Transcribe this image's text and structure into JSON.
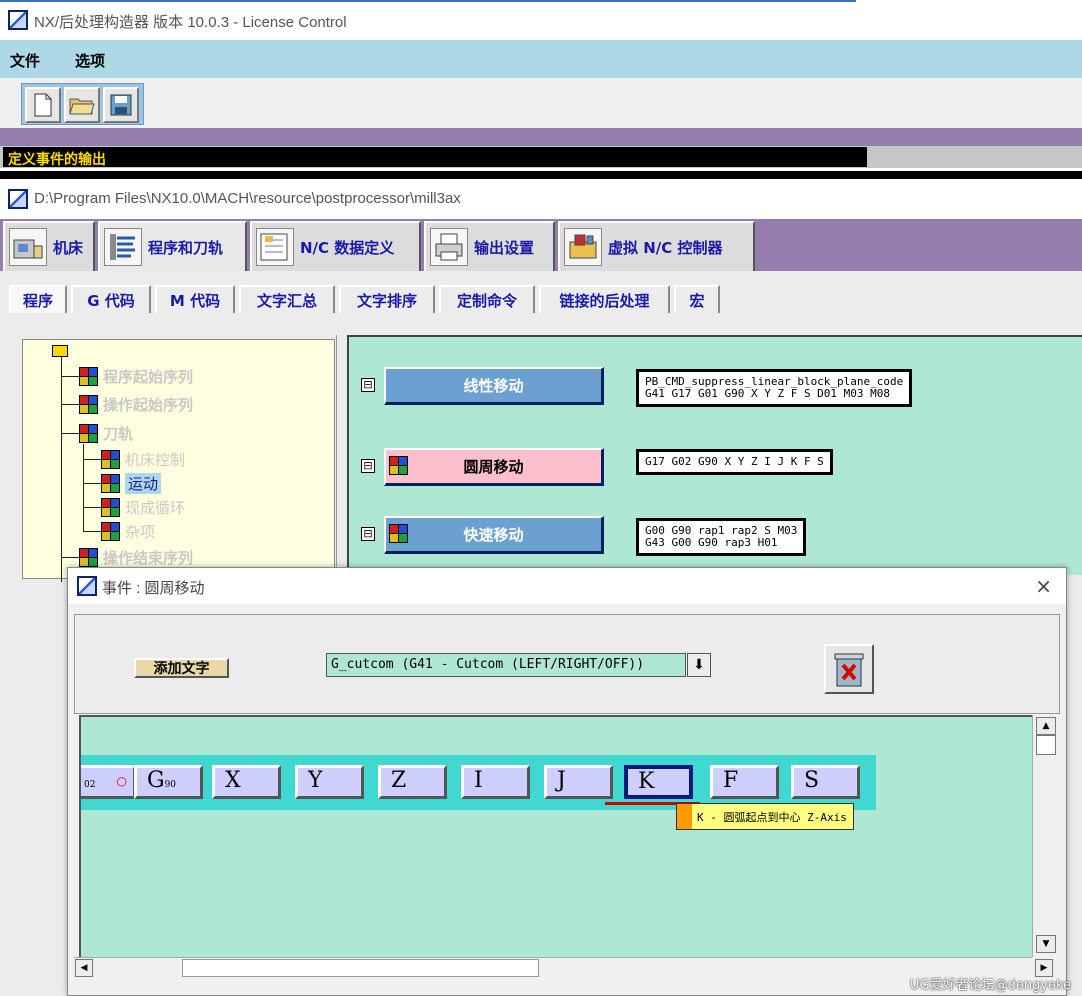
{
  "app": {
    "title": "NX/后处理构造器 版本 10.0.3 - License Control",
    "menu": [
      "文件",
      "选项"
    ],
    "toolbar": [
      "new-file-icon",
      "open-folder-icon",
      "save-disk-icon"
    ],
    "status_text": "定义事件的输出"
  },
  "post_window": {
    "path": "D:\\Program Files\\NX10.0\\MACH\\resource\\postprocessor\\mill3ax",
    "main_tabs": [
      {
        "label": "机床",
        "icon": "machine-tool-icon"
      },
      {
        "label": "程序和刀轨",
        "icon": "program-path-icon",
        "active": true
      },
      {
        "label": "N/C 数据定义",
        "icon": "nc-data-icon"
      },
      {
        "label": "输出设置",
        "icon": "printer-icon"
      },
      {
        "label": "虚拟 N/C 控制器",
        "icon": "virtual-controller-icon"
      }
    ],
    "sub_tabs": [
      "程序",
      "G 代码",
      "M 代码",
      "文字汇总",
      "文字排序",
      "定制命令",
      "链接的后处理",
      "宏"
    ],
    "tree": [
      {
        "label": "程序起始序列"
      },
      {
        "label": "操作起始序列"
      },
      {
        "label": "刀轨"
      },
      {
        "label": "机床控制"
      },
      {
        "label": "运动",
        "selected": true
      },
      {
        "label": "现成循环"
      },
      {
        "label": "杂项"
      },
      {
        "label": "操作结束序列"
      }
    ],
    "events": [
      {
        "name": "线性移动",
        "code": "PB_CMD_suppress_linear_block_plane_code\nG41 G17 G01 G90 X Y Z F S D01 M03 M08"
      },
      {
        "name": "圆周移动",
        "code": "G17 G02 G90 X Y Z I J K F S"
      },
      {
        "name": "快速移动",
        "code": "G00 G90 rap1 rap2 S M03\nG43 G00 G90 rap3 H01"
      }
    ],
    "collapse_symbol": "⊟"
  },
  "dialog": {
    "title": "事件 : 圆周移动",
    "close": "×",
    "add_text_button": "添加文字",
    "combo_value": "G_cutcom (G41 - Cutcom (LEFT/RIGHT/OFF))",
    "combo_arrow": "⬇",
    "words": [
      {
        "label": "",
        "sub": "02"
      },
      {
        "label": "G",
        "sub": "90"
      },
      {
        "label": "X",
        "sub": ""
      },
      {
        "label": "Y",
        "sub": ""
      },
      {
        "label": "Z",
        "sub": ""
      },
      {
        "label": "I",
        "sub": ""
      },
      {
        "label": "J",
        "sub": ""
      },
      {
        "label": "K",
        "sub": "",
        "selected": true
      },
      {
        "label": "F",
        "sub": ""
      },
      {
        "label": "S",
        "sub": ""
      }
    ],
    "tooltip": "K - 圆弧起点到中心 Z-Axis"
  },
  "watermark": "UG爱好者论坛@dengyeke",
  "colors": {
    "menubar": "#add8e6",
    "purple": "#957daf",
    "canvas": "#aee8d5",
    "tree_bg": "#ffffe0",
    "label_blue": "#1a1aa8",
    "status_text": "#ffd800"
  }
}
